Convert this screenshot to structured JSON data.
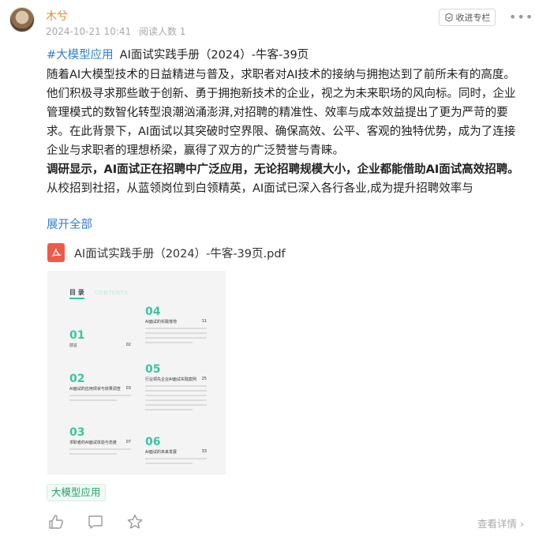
{
  "post": {
    "author": "木兮",
    "date": "2024-10-21 10:41",
    "views": "阅读人数 1",
    "collect_label": "收进专栏",
    "more_label": "•••",
    "hashtag": "#大模型应用",
    "title": "AI面试实践手册（2024）-牛客-39页",
    "paragraph1": "随着AI大模型技术的日益精进与普及，求职者对AI技术的接纳与拥抱达到了前所未有的高度。他们积极寻求那些敢于创新、勇于拥抱新技术的企业，视之为未来职场的风向标。同时，企业管理模式的数智化转型浪潮汹涌澎湃,对招聘的精准性、效率与成本效益提出了更为严苛的要求。在此背景下，AI面试以其突破时空界限、确保高效、公平、客观的独特优势，成为了连接企业与求职者的理想桥梁，赢得了双方的广泛赞誉与青睐。",
    "paragraph2_bold": "调研显示，AI面试正在招聘中广泛应用，无论招聘规模大小，企业都能借助AI面试高效招聘。",
    "paragraph2_rest": "从校招到社招，从蓝领岗位到白领精英，AI面试已深入各行各业,成为提升招聘效率与",
    "expand_label": "展开全部",
    "attachment_name": "AI面试实践手册（2024）-牛客-39页.pdf",
    "tag_chip": "大模型应用",
    "view_detail": "查看详情"
  },
  "preview": {
    "toc_title": "目  录",
    "toc_subtitle": "CONTENTS",
    "sections": [
      {
        "num": "01",
        "title": "前言",
        "page": "02"
      },
      {
        "num": "02",
        "title": "AI面试的应用现状与效果调查",
        "page": "03"
      },
      {
        "num": "03",
        "title": "求职者的AI面试体验与态度",
        "page": "07"
      },
      {
        "num": "04",
        "title": "AI面试的实践落地",
        "page": "11"
      },
      {
        "num": "05",
        "title": "行业领先企业AI面试实践案例",
        "page": "25"
      },
      {
        "num": "06",
        "title": "AI面试的未来发展",
        "page": "33"
      }
    ]
  },
  "icons": {
    "like": "thumbs-up-icon",
    "comment": "comment-icon",
    "star": "star-icon",
    "chevron": "chevron-right-icon",
    "pdf": "pdf-file-icon",
    "collect": "collect-icon"
  },
  "colors": {
    "author": "#e08a2d",
    "link": "#2e7fce",
    "pdf": "#ef5a48",
    "accent_green": "#3cc4a2",
    "tag_green": "#2aa36f"
  }
}
